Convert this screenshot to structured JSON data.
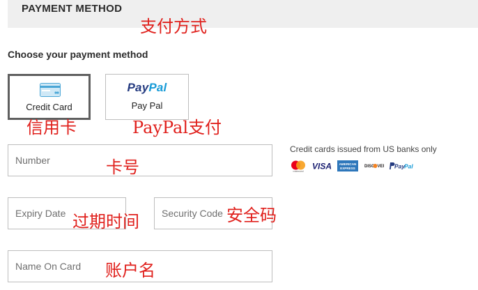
{
  "header": {
    "title": "PAYMENT METHOD"
  },
  "choose_label": "Choose your payment method",
  "methods": [
    {
      "label": "Credit Card",
      "selected": true,
      "icon": "credit-card-icon"
    },
    {
      "label": "Pay Pal",
      "selected": false,
      "logo": "PayPal"
    }
  ],
  "fields": {
    "number": {
      "placeholder": "Number",
      "value": ""
    },
    "expiry": {
      "placeholder": "Expiry Date",
      "value": ""
    },
    "security": {
      "placeholder": "Security Code",
      "value": ""
    },
    "name": {
      "placeholder": "Name On Card",
      "value": ""
    }
  },
  "issued_note": "Credit cards issued from US banks only",
  "card_brands": [
    "mastercard",
    "VISA",
    "AMERICAN EXPRESS",
    "DISCOVER",
    "PayPal"
  ],
  "annotations": {
    "payment_method": "支付方式",
    "credit_card": "信用卡",
    "paypal": "PayPal支付",
    "number": "卡号",
    "expiry": "过期时间",
    "security": "安全码",
    "name": "账户名"
  },
  "colors": {
    "header_bg": "#efefef",
    "annotation": "#e0201c",
    "selected_border": "#5f5f5f",
    "paypal_dark": "#253b80",
    "paypal_light": "#179bd7"
  }
}
